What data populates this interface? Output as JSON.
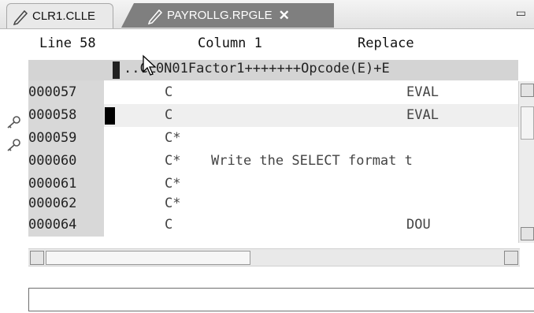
{
  "tabs": [
    {
      "label": "CLR1.CLLE",
      "icon": "pencil-icon",
      "active": false
    },
    {
      "label": "PAYROLLG.RPGLE",
      "icon": "pencil-icon",
      "active": true,
      "close_glyph": "✕"
    }
  ],
  "window": {
    "maximize_glyph": "▭"
  },
  "status": {
    "line_label": "Line 58",
    "column_label": "Column 1",
    "mode_label": "Replace"
  },
  "ruler": {
    "text": "..CL0N01Factor1+++++++Opcode(E)+E"
  },
  "lines": [
    {
      "num": "000057",
      "spec": "C",
      "text": "",
      "opcode": "EVAL",
      "marker": "key-icon"
    },
    {
      "num": "000058",
      "spec": "C",
      "text": "",
      "opcode": "EVAL",
      "marker": "key-icon",
      "current": true
    },
    {
      "num": "000059",
      "spec": "C*",
      "text": "",
      "opcode": ""
    },
    {
      "num": "000060",
      "spec": "C*",
      "text": "Write the SELECT format t",
      "opcode": ""
    },
    {
      "num": "000061",
      "spec": "C*",
      "text": "",
      "opcode": ""
    },
    {
      "num": "000062",
      "spec": "C*",
      "text": "",
      "opcode": ""
    },
    {
      "num": "000064",
      "spec": "C",
      "text": "",
      "opcode": "DOU"
    }
  ],
  "command_line": {
    "value": ""
  }
}
